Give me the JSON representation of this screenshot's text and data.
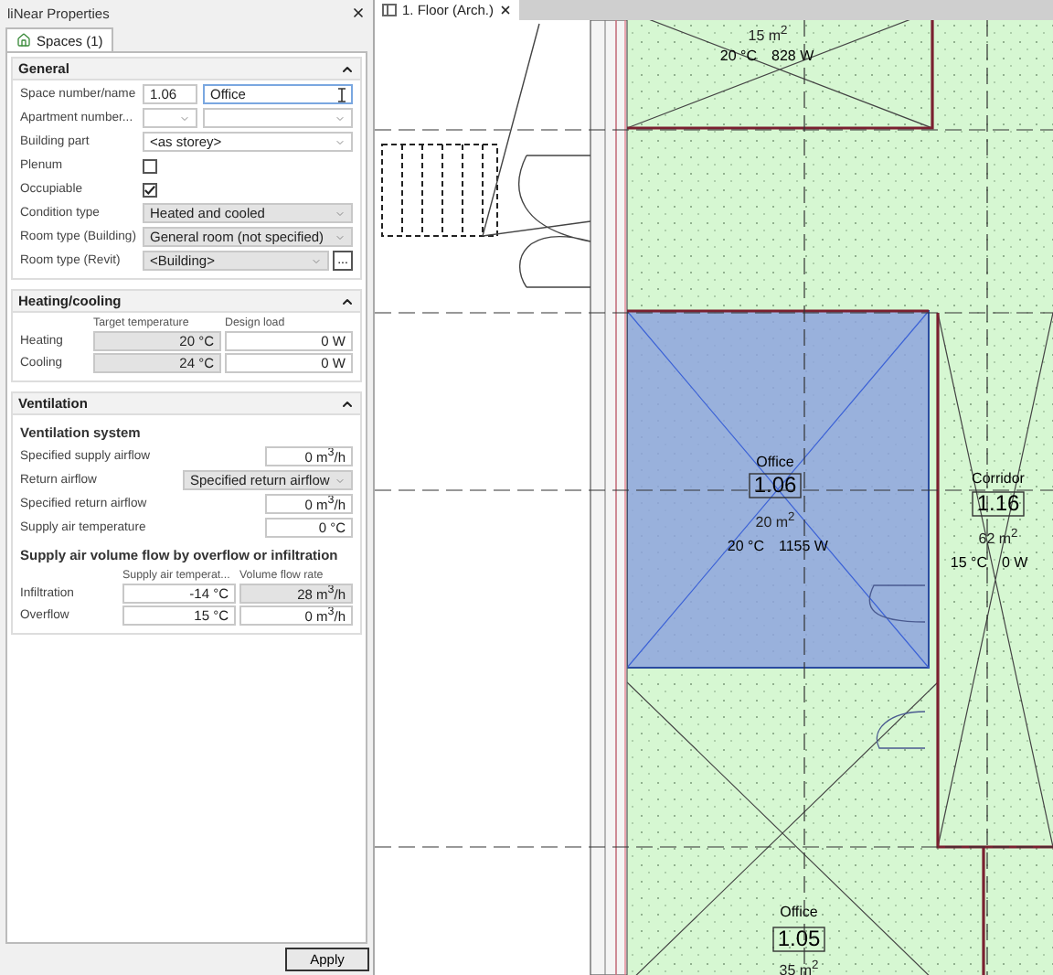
{
  "panel": {
    "title": "liNear Properties",
    "tabs": [
      {
        "label": "Spaces (1)",
        "selected": true
      }
    ],
    "sections": [
      {
        "title": "General",
        "expanded": true,
        "blocks": [
          {
            "kind": "number_name",
            "label": "Space number/name",
            "number": "1.06",
            "name": "Office",
            "focused": true
          },
          {
            "kind": "dual_select",
            "label": "Apartment number..."
          },
          {
            "kind": "select",
            "label": "Building part",
            "value": "<as storey>",
            "disabled": false
          },
          {
            "kind": "checkbox",
            "label": "Plenum",
            "checked": false
          },
          {
            "kind": "checkbox",
            "label": "Occupiable",
            "checked": true
          },
          {
            "kind": "select",
            "label": "Condition type",
            "value": "Heated and cooled",
            "disabled": true
          },
          {
            "kind": "select",
            "label": "Room type (Building)",
            "value": "General room (not specified)",
            "disabled": true
          },
          {
            "kind": "select_button",
            "label": "Room type (Revit)",
            "value": "<Building>",
            "button": "...",
            "disabled": true
          }
        ]
      },
      {
        "title": "Heating/cooling",
        "expanded": true,
        "blocks": [
          {
            "kind": "grid",
            "columns": [
              "Target temperature",
              "Design load"
            ],
            "rows": [
              {
                "label": "Heating",
                "cells": [
                  {
                    "value": "20 °C",
                    "readonly": true
                  },
                  {
                    "value": "0 W",
                    "readonly": false
                  }
                ]
              },
              {
                "label": "Cooling",
                "cells": [
                  {
                    "value": "24 °C",
                    "readonly": true
                  },
                  {
                    "value": "0 W",
                    "readonly": false
                  }
                ]
              }
            ]
          }
        ]
      },
      {
        "title": "Ventilation",
        "expanded": true,
        "blocks": [
          {
            "kind": "heading",
            "label": "Ventilation system"
          },
          {
            "kind": "short_field",
            "label": "Specified supply airflow",
            "value": "0 m$^{3}$/h"
          },
          {
            "kind": "short_select",
            "label": "Return airflow",
            "value": "Specified return airflow"
          },
          {
            "kind": "short_field",
            "label": "Specified return airflow",
            "value": "0 m$^{3}$/h"
          },
          {
            "kind": "short_field",
            "label": "Supply air temperature",
            "value": "0 °C"
          },
          {
            "kind": "heading",
            "label": "Supply air volume flow by overflow or infiltration"
          },
          {
            "kind": "grid",
            "columns": [
              "Supply air temperat...",
              "Volume flow rate"
            ],
            "rows": [
              {
                "label": "Infiltration",
                "cells": [
                  {
                    "value": "-14 °C",
                    "readonly": false
                  },
                  {
                    "value": "28 m$^{3}$/h",
                    "readonly": true
                  }
                ]
              },
              {
                "label": "Overflow",
                "cells": [
                  {
                    "value": "15 °C",
                    "readonly": false
                  },
                  {
                    "value": "0 m$^{3}$/h",
                    "readonly": false
                  }
                ]
              }
            ]
          }
        ]
      }
    ],
    "apply": "Apply"
  },
  "view": {
    "tabs": [
      {
        "label": "1. Floor (Arch.)",
        "selected": true
      }
    ],
    "rooms": [
      {
        "area": "15 m$^{2}$",
        "temperature": "20 °C",
        "load": "828 W",
        "selected": false
      },
      {
        "name": "Office",
        "number": "1.06",
        "area": "20 m$^{2}$",
        "temperature": "20 °C",
        "load": "1155 W",
        "selected": true
      },
      {
        "name": "Corridor",
        "number": "1.16",
        "area": "62 m$^{2}$",
        "temperature": "15 °C",
        "load": "0 W",
        "selected": false
      },
      {
        "name": "Office",
        "number": "1.05",
        "area": "35 m$^{2}$",
        "selected": false
      }
    ]
  }
}
